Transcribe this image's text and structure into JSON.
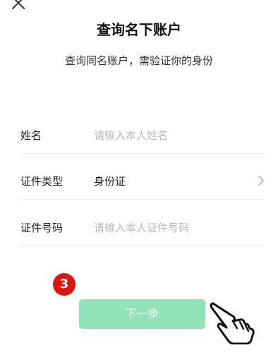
{
  "header": {
    "close_icon": "close-icon",
    "title": "查询名下账户",
    "subtitle": "查询同名账户，需验证你的身份"
  },
  "form": {
    "name": {
      "label": "姓名",
      "placeholder": "请输入本人姓名"
    },
    "id_type": {
      "label": "证件类型",
      "value": "身份证",
      "chevron_icon": "chevron-right-icon"
    },
    "id_number": {
      "label": "证件号码",
      "placeholder": "请输入本人证件号码"
    }
  },
  "step_badge": "3",
  "next_button": {
    "label": "下一步",
    "color": "#92e3b8"
  },
  "colors": {
    "badge": "#e0150f",
    "accent": "#07c160"
  },
  "pointer_icon": "hand-pointer-icon"
}
